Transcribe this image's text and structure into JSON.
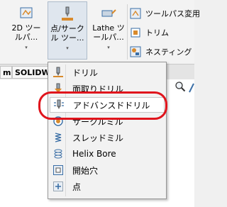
{
  "ribbon": {
    "buttons": [
      {
        "label": "2D ツー\nルパ...",
        "icon": "2d-toolpath-icon"
      },
      {
        "label": "点/サーク\nル ツー...",
        "icon": "drill-point-icon"
      },
      {
        "label": "Lathe ツ\nールパ...",
        "icon": "lathe-toolpath-icon"
      }
    ],
    "small_items": [
      {
        "label": "ツールパス変用",
        "icon": "toolpath-transform-icon"
      },
      {
        "label": "トリム",
        "icon": "trim-icon"
      },
      {
        "label": "ネスティング",
        "icon": "nesting-icon"
      }
    ],
    "caret": "▾"
  },
  "tabs": [
    {
      "label": "m"
    },
    {
      "label": "SOLIDW"
    }
  ],
  "menu": {
    "items": [
      {
        "label": "ドリル",
        "icon": "drill-icon"
      },
      {
        "label": "面取りドリル",
        "icon": "chamfer-drill-icon"
      },
      {
        "label": "アドバンスドドリル",
        "icon": "advanced-drill-icon"
      },
      {
        "label": "サークルミル",
        "icon": "circle-mill-icon"
      },
      {
        "label": "スレッドミル",
        "icon": "thread-mill-icon"
      },
      {
        "label": "Helix Bore",
        "icon": "helix-bore-icon"
      },
      {
        "label": "開始穴",
        "icon": "start-hole-icon"
      },
      {
        "label": "点",
        "icon": "point-icon"
      }
    ]
  },
  "colors": {
    "highlight_ring": "#e0141c",
    "icon_blue": "#3a6ea5",
    "icon_orange": "#d98a2b"
  }
}
